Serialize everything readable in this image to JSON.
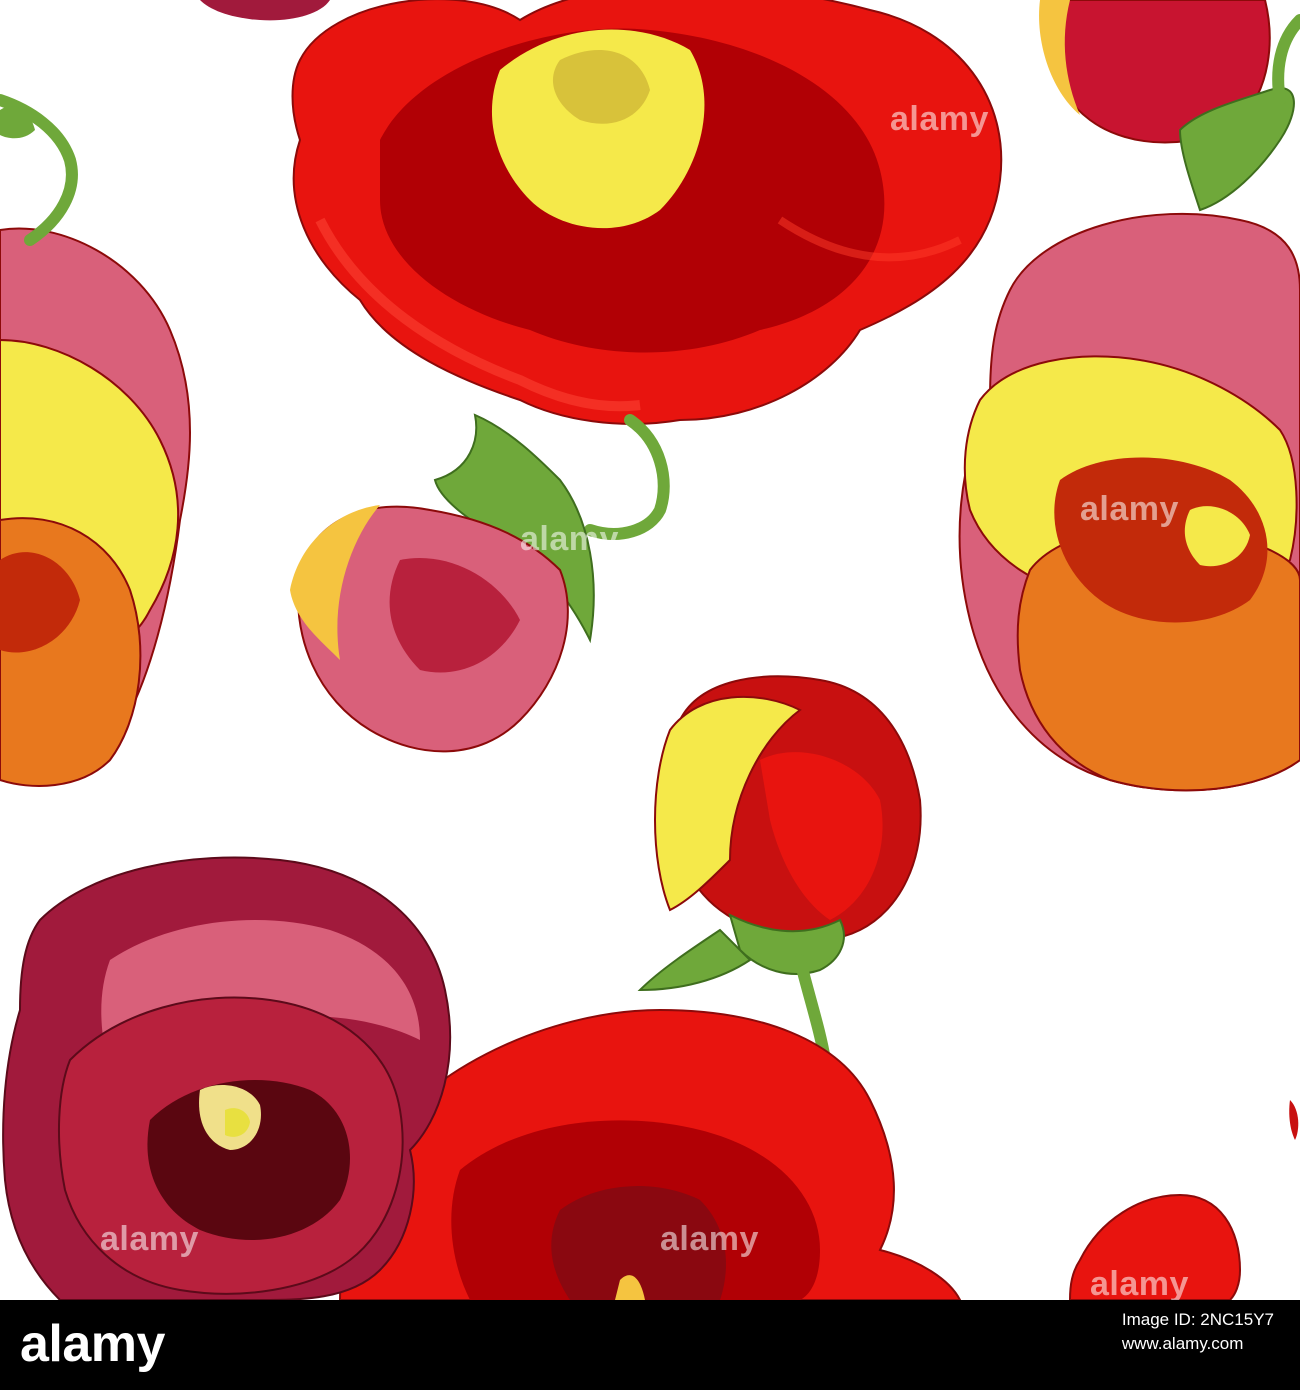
{
  "watermark": {
    "text": "alamy"
  },
  "footer": {
    "logo_text": "alamy",
    "image_id_label": "Image ID: 2NC15Y7",
    "site": "www.alamy.com"
  },
  "palette": {
    "red": "#e8140f",
    "dark_red": "#b10005",
    "maroon": "#7d0c16",
    "yellow": "#f5e94a",
    "orange": "#e8781e",
    "pink": "#d9607a",
    "crimson": "#a11a3c",
    "green": "#6fa83a",
    "background": "#ffffff"
  }
}
